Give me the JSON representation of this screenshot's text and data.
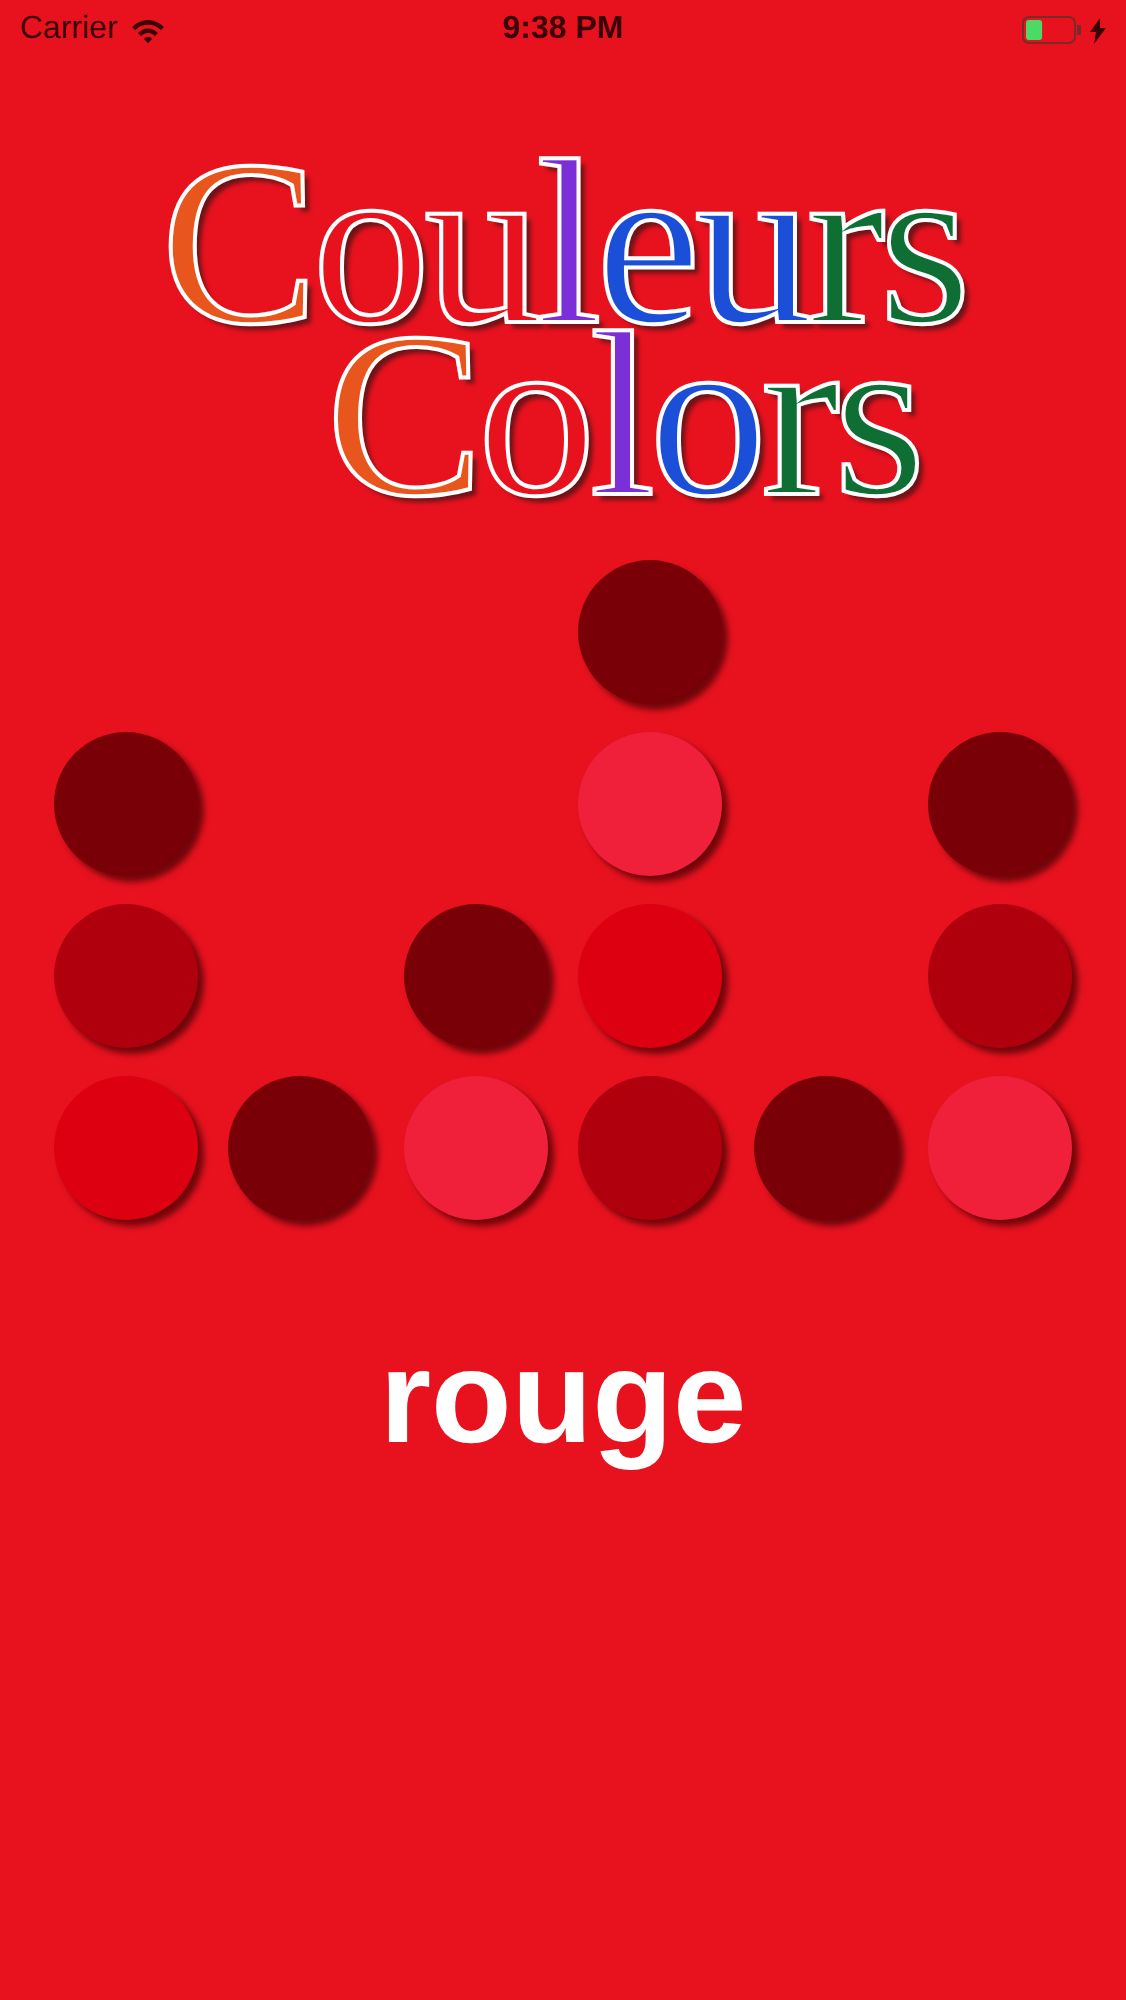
{
  "status_bar": {
    "carrier": "Carrier",
    "time": "9:38 PM",
    "battery": {
      "level": 0.35,
      "charging": true
    }
  },
  "logo": [
    {
      "segments": [
        {
          "text": "C",
          "color": "#e8561e"
        },
        {
          "text": "ou",
          "color": "#e8121f"
        },
        {
          "text": "l",
          "color": "#7b2fd6"
        },
        {
          "text": "eu",
          "color": "#1b4fd8"
        },
        {
          "text": "rs",
          "color": "#0f6e34"
        }
      ]
    },
    {
      "segments": [
        {
          "text": "C",
          "color": "#e8561e"
        },
        {
          "text": "o",
          "color": "#e8121f"
        },
        {
          "text": "l",
          "color": "#7b2fd6"
        },
        {
          "text": "o",
          "color": "#1b4fd8"
        },
        {
          "text": "rs",
          "color": "#0f6e34"
        }
      ]
    }
  ],
  "board": {
    "rows": [
      {
        "cells": [
          {
            "kind": "empty"
          },
          {
            "kind": "empty"
          },
          {
            "kind": "empty"
          },
          {
            "kind": "dot",
            "color": "#7a0008"
          },
          {
            "kind": "empty"
          },
          {
            "kind": "empty"
          }
        ]
      },
      {
        "cells": [
          {
            "kind": "dot",
            "color": "#7a0008"
          },
          {
            "kind": "empty"
          },
          {
            "kind": "empty"
          },
          {
            "kind": "dot",
            "color": "#f0203a"
          },
          {
            "kind": "empty"
          },
          {
            "kind": "dot",
            "color": "#7a0008"
          }
        ]
      },
      {
        "cells": [
          {
            "kind": "dot",
            "color": "#b0000e"
          },
          {
            "kind": "empty"
          },
          {
            "kind": "dot",
            "color": "#7a0008"
          },
          {
            "kind": "dot",
            "color": "#dc0010"
          },
          {
            "kind": "empty"
          },
          {
            "kind": "dot",
            "color": "#b0000e"
          }
        ]
      },
      {
        "cells": [
          {
            "kind": "dot",
            "color": "#dc0010"
          },
          {
            "kind": "dot",
            "color": "#7a0008"
          },
          {
            "kind": "dot",
            "color": "#f0203a"
          },
          {
            "kind": "dot",
            "color": "#b0000e"
          },
          {
            "kind": "dot",
            "color": "#7a0008"
          },
          {
            "kind": "dot",
            "color": "#f0203a"
          }
        ]
      }
    ]
  },
  "word": "rouge"
}
